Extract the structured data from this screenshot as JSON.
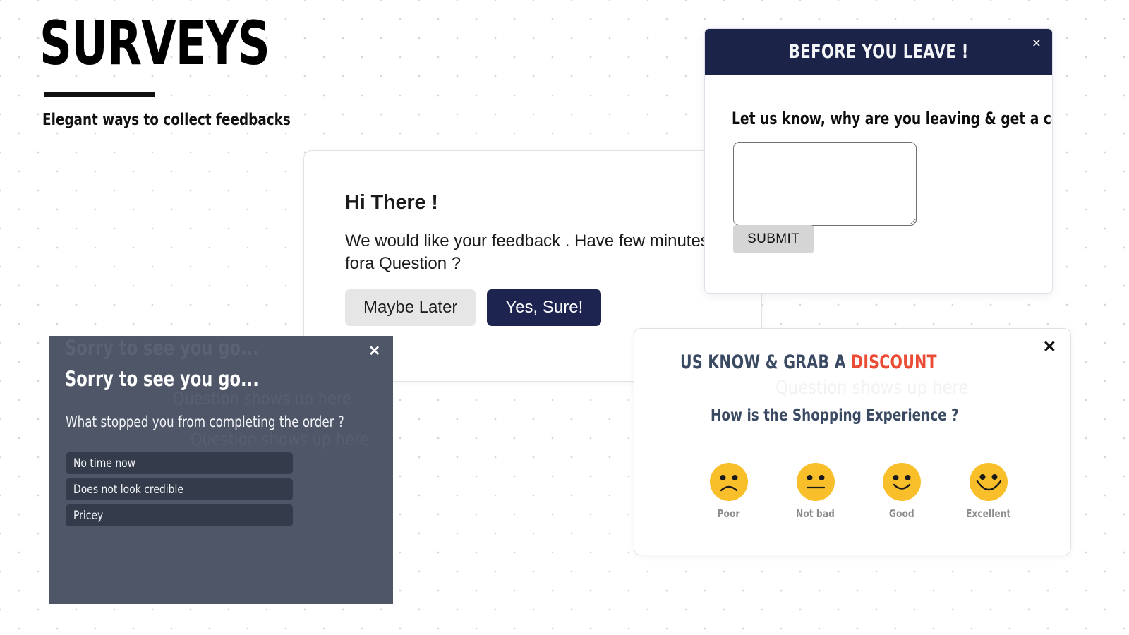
{
  "masthead": {
    "title": "SURVEYS",
    "tagline": "Elegant ways to collect feedbacks"
  },
  "hi_there_card": {
    "title": "Hi There !",
    "body": "We would like your feedback . Have few minutes fora Question ?",
    "maybe_later_label": "Maybe Later",
    "yes_sure_label": "Yes, Sure!"
  },
  "before_leave_modal": {
    "title": "BEFORE YOU LEAVE !",
    "close_label": "×",
    "prompt": "Let us know, why are you leaving & get a coupon !",
    "textarea_value": "",
    "textarea_placeholder": "",
    "submit_label": "SUBMIT"
  },
  "sorry_modal": {
    "ghost_title": "Sorry to see you go...",
    "ghost_sub": "Question shows up here",
    "ghost_sub2": "Question shows up here",
    "close_label": "✕",
    "title": "Sorry to see you go...",
    "question": "What stopped you from completing the order ?",
    "options": [
      {
        "label": "No time now"
      },
      {
        "label": "Does not look credible"
      },
      {
        "label": "Pricey"
      }
    ]
  },
  "discount_card": {
    "heading_prefix": "US KNOW & GRAB A ",
    "heading_accent": "DISCOUNT",
    "ghost_text": "Question shows up here",
    "close_label": "✕",
    "subheading": "How is the Shopping Experience ?",
    "ratings": [
      {
        "label": "Poor",
        "mood": "sad-face-icon"
      },
      {
        "label": "Not bad",
        "mood": "neutral-face-icon"
      },
      {
        "label": "Good",
        "mood": "happy-face-icon"
      },
      {
        "label": "Excellent",
        "mood": "very-happy-face-icon"
      }
    ]
  },
  "colors": {
    "navy": "#1c2349",
    "slate": "#4e5668",
    "slate_option": "#343b4a",
    "heading_blue": "#3b4a63",
    "accent_red": "#ea4b35",
    "emoji_yellow": "#f9bf2b"
  }
}
